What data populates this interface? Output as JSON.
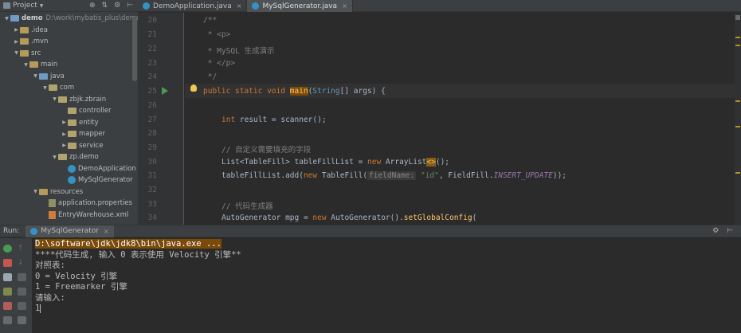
{
  "project": {
    "title": "Project",
    "items": [
      {
        "label": "demo",
        "path": "D:\\work\\mybatis_plus\\demo",
        "depth": 0,
        "open": true,
        "kind": "folder-blue"
      },
      {
        "label": ".idea",
        "depth": 1,
        "open": false,
        "kind": "folder"
      },
      {
        "label": ".mvn",
        "depth": 1,
        "open": false,
        "kind": "folder"
      },
      {
        "label": "src",
        "depth": 1,
        "open": true,
        "kind": "folder"
      },
      {
        "label": "main",
        "depth": 2,
        "open": true,
        "kind": "folder"
      },
      {
        "label": "java",
        "depth": 3,
        "open": true,
        "kind": "folder-blue"
      },
      {
        "label": "com",
        "depth": 4,
        "open": true,
        "kind": "pkg"
      },
      {
        "label": "zbjk.zbrain",
        "depth": 5,
        "open": true,
        "kind": "pkg"
      },
      {
        "label": "controller",
        "depth": 6,
        "open": null,
        "kind": "pkg"
      },
      {
        "label": "entity",
        "depth": 6,
        "open": false,
        "kind": "pkg"
      },
      {
        "label": "mapper",
        "depth": 6,
        "open": false,
        "kind": "pkg"
      },
      {
        "label": "service",
        "depth": 6,
        "open": false,
        "kind": "pkg"
      },
      {
        "label": "zp.demo",
        "depth": 5,
        "open": true,
        "kind": "pkg"
      },
      {
        "label": "DemoApplication",
        "depth": 6,
        "open": null,
        "kind": "class"
      },
      {
        "label": "MySqlGenerator",
        "depth": 6,
        "open": null,
        "kind": "class"
      },
      {
        "label": "resources",
        "depth": 3,
        "open": true,
        "kind": "folder"
      },
      {
        "label": "application.properties",
        "depth": 4,
        "open": null,
        "kind": "props"
      },
      {
        "label": "EntryWarehouse.xml",
        "depth": 4,
        "open": null,
        "kind": "xml"
      }
    ]
  },
  "tabs": [
    {
      "label": "DemoApplication.java",
      "active": false
    },
    {
      "label": "MySqlGenerator.java",
      "active": true
    }
  ],
  "editor": {
    "lines": [
      {
        "num": "20",
        "text": "/**"
      },
      {
        "num": "21",
        "text": " * <p>"
      },
      {
        "num": "22",
        "text": " * MySQL 生成演示"
      },
      {
        "num": "23",
        "text": " * </p>"
      },
      {
        "num": "24",
        "text": " */"
      },
      {
        "num": "25",
        "kw1": "public static void ",
        "fn": "main",
        "rest_open": "(",
        "type": "String",
        "rest": "[] args) {"
      },
      {
        "num": "26",
        "text": ""
      },
      {
        "num": "27",
        "kw": "int",
        "rest": " result = scanner();"
      },
      {
        "num": "28",
        "text": ""
      },
      {
        "num": "29",
        "text": "// 自定义需要填充的字段"
      },
      {
        "num": "30",
        "a": "List<TableFill> tableFillList = ",
        "kw": "new",
        "b": " ArrayList",
        "gen": "<>",
        "c": "();"
      },
      {
        "num": "31",
        "a": "tableFillList.add(",
        "kw": "new",
        "b": " TableFill(",
        "hint": "fieldName:",
        "str": " \"id\"",
        "c": ", FieldFill.",
        "fld": "INSERT_UPDATE",
        "d": "));"
      },
      {
        "num": "32",
        "text": ""
      },
      {
        "num": "33",
        "text": "// 代码生成器"
      },
      {
        "num": "34",
        "a": "AutoGenerator mpg = ",
        "kw": "new",
        "b": " AutoGenerator().",
        "fnc": "setGlobalConfig",
        "c": "("
      }
    ]
  },
  "run": {
    "label": "Run:",
    "tab": "MySqlGenerator",
    "console": [
      "D:\\software\\jdk\\jdk8\\bin\\java.exe ...",
      "****代码生成, 输入 0 表示使用 Velocity 引擎**",
      "对照表:",
      "0 = Velocity 引擎",
      "1 = Freemarker 引擎",
      "请输入:",
      "1"
    ]
  }
}
